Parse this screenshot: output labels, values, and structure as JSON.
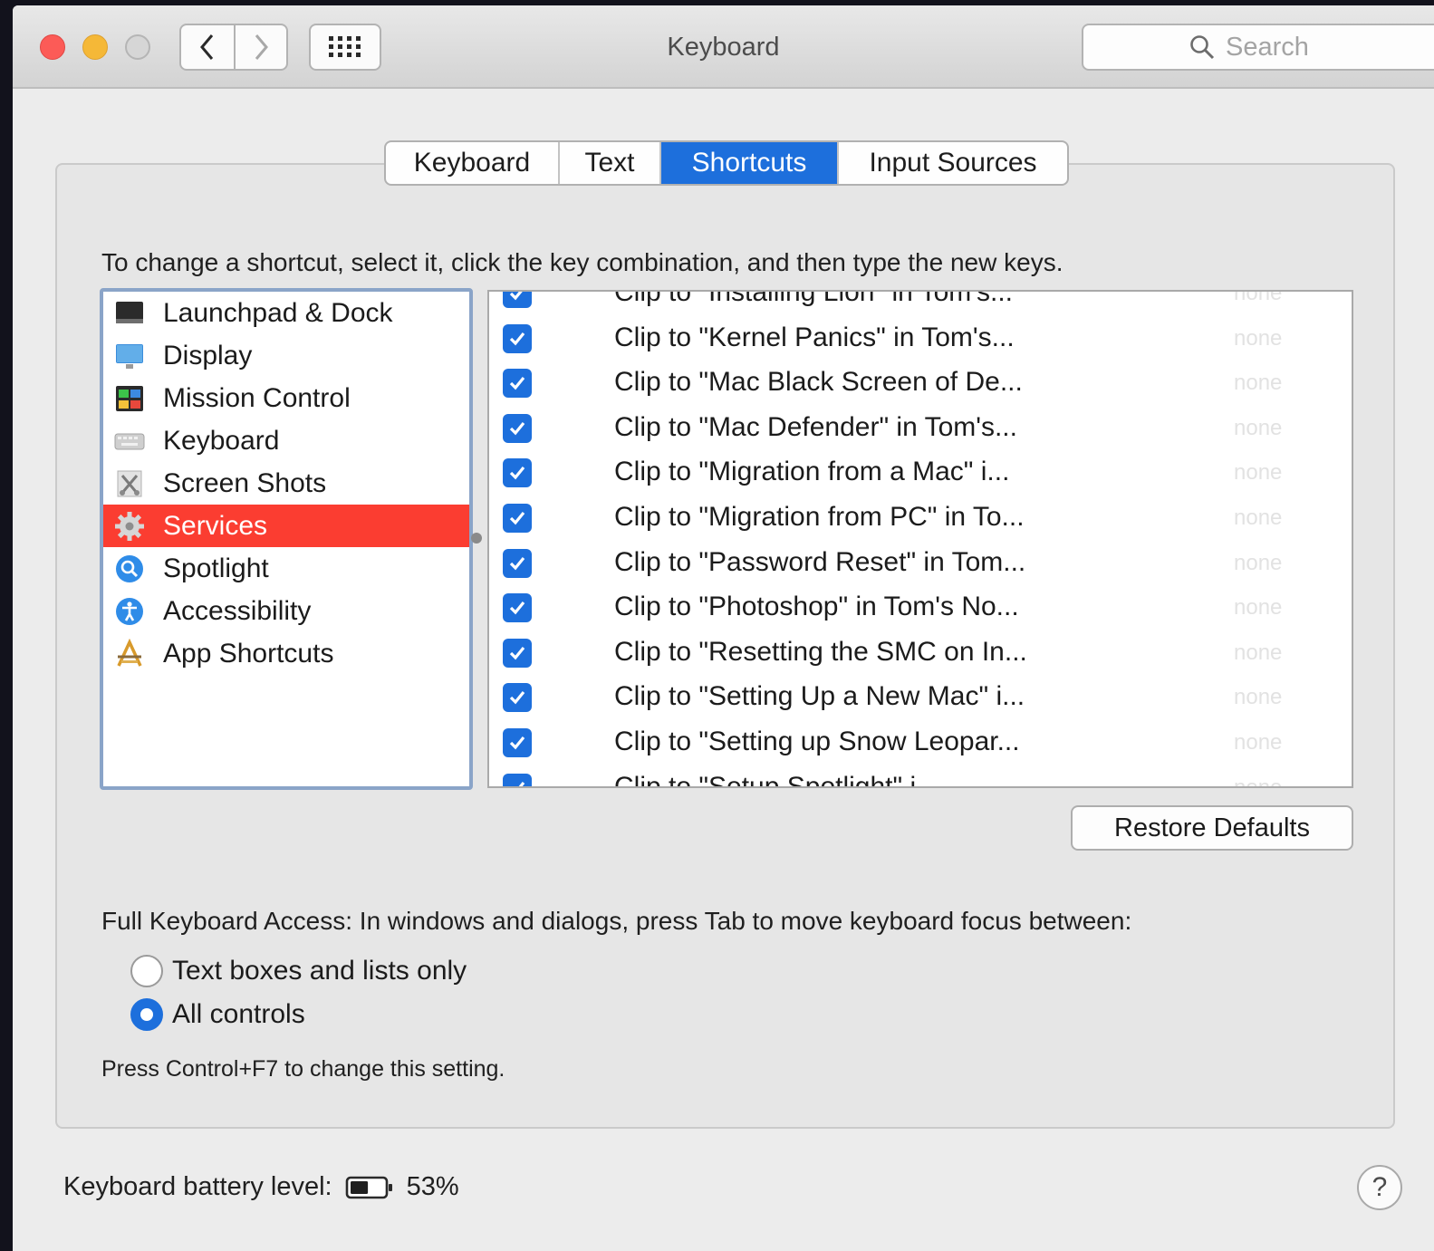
{
  "window": {
    "title": "Keyboard",
    "search_placeholder": "Search",
    "traffic_lights": [
      "close-button",
      "minimize-button",
      "zoom-button"
    ],
    "icons": {
      "back": "chevron-left-icon",
      "forward": "chevron-right-icon",
      "show_all": "grid-icon",
      "search": "magnifier-icon"
    }
  },
  "tabs": [
    {
      "label": "Keyboard",
      "active": false
    },
    {
      "label": "Text",
      "active": false
    },
    {
      "label": "Shortcuts",
      "active": true
    },
    {
      "label": "Input Sources",
      "active": false
    }
  ],
  "shortcuts": {
    "hint": "To change a shortcut, select it, click the key combination, and then type the new keys.",
    "categories": [
      {
        "label": "Launchpad & Dock",
        "icon": "launchpad-dock-icon"
      },
      {
        "label": "Display",
        "icon": "display-icon"
      },
      {
        "label": "Mission Control",
        "icon": "mission-control-icon"
      },
      {
        "label": "Keyboard",
        "icon": "keyboard-icon"
      },
      {
        "label": "Screen Shots",
        "icon": "screen-shots-icon"
      },
      {
        "label": "Services",
        "icon": "gear-icon",
        "selected": true
      },
      {
        "label": "Spotlight",
        "icon": "spotlight-icon"
      },
      {
        "label": "Accessibility",
        "icon": "accessibility-icon"
      },
      {
        "label": "App Shortcuts",
        "icon": "app-shortcuts-icon"
      }
    ],
    "services": [
      {
        "label": "Clip to \"Installing Lion\" in Tom's...",
        "key": "none",
        "checked": true
      },
      {
        "label": "Clip to \"Kernel Panics\" in Tom's...",
        "key": "none",
        "checked": true
      },
      {
        "label": "Clip to \"Mac Black Screen of De...",
        "key": "none",
        "checked": true
      },
      {
        "label": "Clip to \"Mac Defender\" in Tom's...",
        "key": "none",
        "checked": true
      },
      {
        "label": "Clip to \"Migration from a Mac\" i...",
        "key": "none",
        "checked": true
      },
      {
        "label": "Clip to \"Migration from PC\" in To...",
        "key": "none",
        "checked": true
      },
      {
        "label": "Clip to \"Password Reset\" in Tom...",
        "key": "none",
        "checked": true
      },
      {
        "label": "Clip to \"Photoshop\" in Tom's No...",
        "key": "none",
        "checked": true
      },
      {
        "label": "Clip to \"Resetting the SMC on In...",
        "key": "none",
        "checked": true
      },
      {
        "label": "Clip to \"Setting Up a New Mac\" i...",
        "key": "none",
        "checked": true
      },
      {
        "label": "Clip to \"Setting up Snow Leopar...",
        "key": "none",
        "checked": true
      },
      {
        "label": "Clip to \"Setup Spotlight\" i...",
        "key": "none",
        "checked": true
      }
    ],
    "restore_label": "Restore Defaults"
  },
  "full_keyboard_access": {
    "label": "Full Keyboard Access: In windows and dialogs, press Tab to move keyboard focus between:",
    "options": [
      {
        "label": "Text boxes and lists only",
        "selected": false
      },
      {
        "label": "All controls",
        "selected": true
      }
    ],
    "note": "Press Control+F7 to change this setting."
  },
  "battery": {
    "label": "Keyboard battery level:",
    "value": "53%",
    "level": 0.53
  },
  "help_label": "?",
  "colors": {
    "accent": "#1d6fdc",
    "selection": "#fb3d31",
    "close": "#fc5b57",
    "minimize": "#f5b837"
  }
}
